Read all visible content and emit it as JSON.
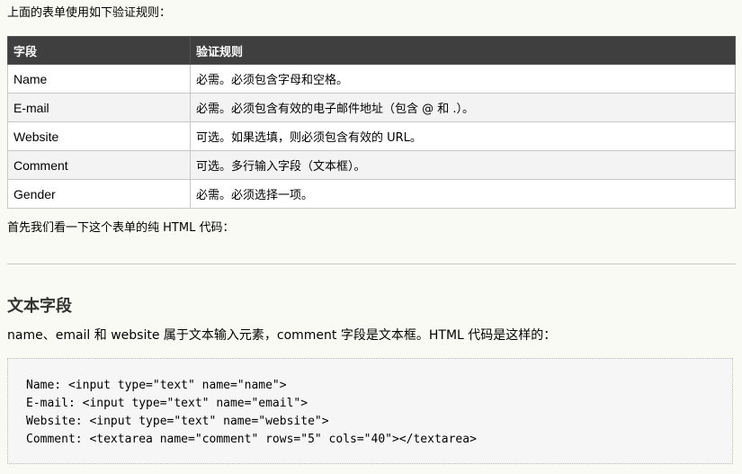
{
  "intro": "上面的表单使用如下验证规则：",
  "table": {
    "headers": [
      "字段",
      "验证规则"
    ],
    "rows": [
      {
        "field": "Name",
        "rule": "必需。必须包含字母和空格。"
      },
      {
        "field": "E-mail",
        "rule": "必需。必须包含有效的电子邮件地址（包含 @ 和 .）。"
      },
      {
        "field": "Website",
        "rule": "可选。如果选填，则必须包含有效的 URL。"
      },
      {
        "field": "Comment",
        "rule": "可选。多行输入字段（文本框）。"
      },
      {
        "field": "Gender",
        "rule": "必需。必须选择一项。"
      }
    ]
  },
  "after_table": "首先我们看一下这个表单的纯 HTML 代码：",
  "section": {
    "title": "文本字段",
    "description": "name、email 和 website 属于文本输入元素，comment 字段是文本框。HTML 代码是这样的：",
    "code_lines": [
      "Name: <input type=\"text\" name=\"name\">",
      "E-mail: <input type=\"text\" name=\"email\">",
      "Website: <input type=\"text\" name=\"website\">",
      "Comment: <textarea name=\"comment\" rows=\"5\" cols=\"40\"></textarea>"
    ]
  }
}
